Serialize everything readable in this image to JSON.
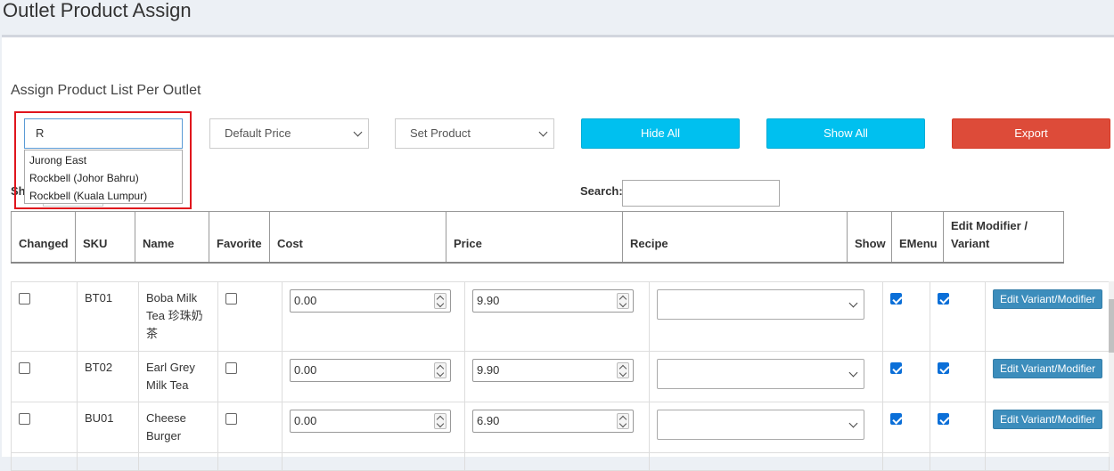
{
  "page": {
    "title": "Outlet Product Assign",
    "subtitle": "Assign Product List Per Outlet"
  },
  "filters": {
    "outlet_search_value": "R",
    "outlet_options": [
      "Jurong East",
      "Rockbell (Johor Bahru)",
      "Rockbell (Kuala Lumpur)"
    ],
    "price_select": "Default Price",
    "product_select": "Set Product",
    "hide_all": "Hide All",
    "show_all": "Show All",
    "export": "Export",
    "show_label": "Sh",
    "search_label": "Search:"
  },
  "table": {
    "headers": {
      "changed": "Changed",
      "sku": "SKU",
      "name": "Name",
      "favorite": "Favorite",
      "cost": "Cost",
      "price": "Price",
      "recipe": "Recipe",
      "show": "Show",
      "emenu": "EMenu",
      "edit": "Edit Modifier / Variant"
    },
    "edit_button_label": "Edit Variant/Modifier",
    "rows": [
      {
        "sku": "BT01",
        "name": "Boba Milk Tea 珍珠奶茶",
        "cost": "0.00",
        "price": "9.90"
      },
      {
        "sku": "BT02",
        "name": "Earl Grey Milk Tea",
        "cost": "0.00",
        "price": "9.90"
      },
      {
        "sku": "BU01",
        "name": "Cheese Burger",
        "cost": "0.00",
        "price": "6.90"
      }
    ]
  },
  "colors": {
    "cyan_button": "#00c0ef",
    "red_button": "#dd4b39",
    "edit_button": "#3c8dbc",
    "highlight": "#e0151d"
  }
}
